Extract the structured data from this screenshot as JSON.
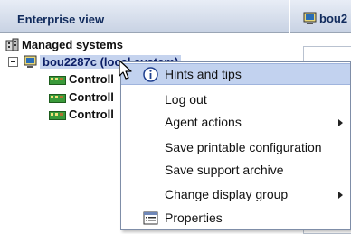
{
  "tree_panel": {
    "header_title": "Enterprise view",
    "root_label": "Managed systems",
    "system_label": "bou2287c (local system)",
    "controllers": [
      "Controll",
      "Controll",
      "Controll"
    ]
  },
  "right_panel": {
    "tab_label": "bou2"
  },
  "context_menu": {
    "items": [
      {
        "label": "Hints and tips",
        "icon": "info-icon",
        "highlighted": true
      },
      {
        "label": "Log out"
      },
      {
        "label": "Agent actions",
        "submenu": true
      },
      {
        "label": "Save printable configuration"
      },
      {
        "label": "Save support archive"
      },
      {
        "label": "Change display group",
        "submenu": true
      },
      {
        "label": "Properties",
        "icon": "properties-icon"
      }
    ]
  },
  "colors": {
    "accent": "#c2d2ef",
    "header_text": "#102a5c",
    "controller_icon": "#2d8a2d"
  }
}
